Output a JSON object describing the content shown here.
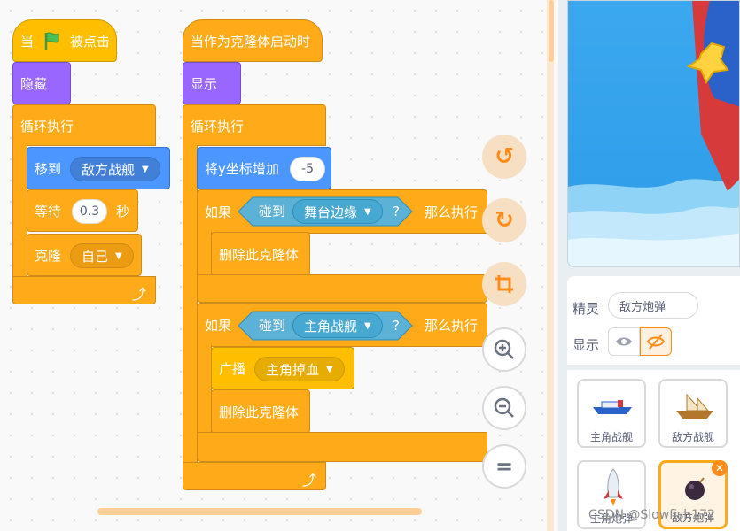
{
  "script1": {
    "hat_when": "当",
    "hat_clicked": "被点击",
    "hide": "隐藏",
    "forever": "循环执行",
    "goto": "移到",
    "goto_target": "敌方战舰",
    "wait": "等待",
    "wait_value": "0.3",
    "wait_unit": "秒",
    "clone": "克隆",
    "clone_target": "自己"
  },
  "script2": {
    "hat": "当作为克隆体启动时",
    "show": "显示",
    "forever": "循环执行",
    "change_y": "将y坐标增加",
    "change_y_value": "-5",
    "if1": "如果",
    "touching1": "碰到",
    "touching1_target": "舞台边缘",
    "q1": "?",
    "then1": "那么执行",
    "delete1": "删除此克隆体",
    "if2": "如果",
    "touching2": "碰到",
    "touching2_target": "主角战舰",
    "q2": "?",
    "then2": "那么执行",
    "broadcast": "广播",
    "broadcast_msg": "主角掉血",
    "delete2": "删除此克隆体"
  },
  "sprite_info": {
    "label": "精灵",
    "name": "敌方炮弹",
    "show_label": "显示"
  },
  "sprites": [
    {
      "name": "主角战舰"
    },
    {
      "name": "敌方战舰"
    },
    {
      "name": "主角炮弹"
    },
    {
      "name": "敌方炮弹"
    }
  ],
  "watermark": "CSDN @Slowfish172",
  "colors": {
    "events": "#ffbf00",
    "control": "#ffab19",
    "looks": "#9966ff",
    "motion": "#4c97ff",
    "sensing": "#5cb1d6"
  }
}
